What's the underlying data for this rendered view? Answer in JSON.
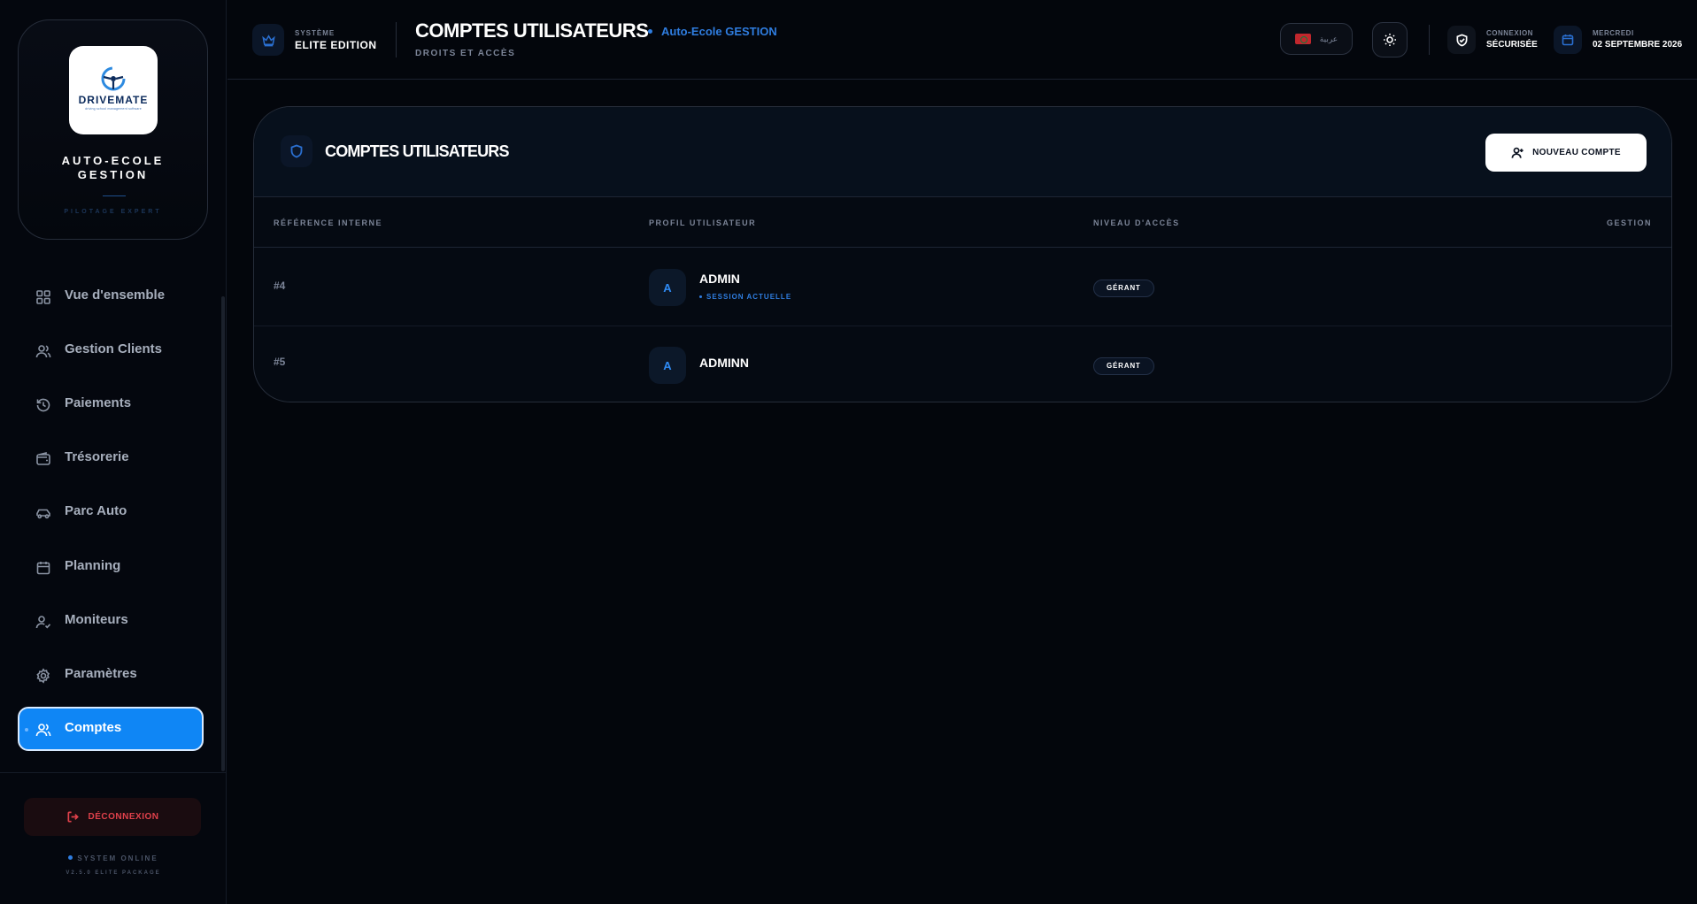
{
  "sidebar": {
    "logo": {
      "name": "DRIVEMATE",
      "tagline": "driving school management software"
    },
    "brand_title_line1": "AUTO-ECOLE",
    "brand_title_line2": "GESTION",
    "brand_subtitle": "PILOTAGE EXPERT",
    "items": [
      {
        "label": "Vue d'ensemble",
        "icon": "grid-icon"
      },
      {
        "label": "Gestion Clients",
        "icon": "users-icon"
      },
      {
        "label": "Paiements",
        "icon": "history-icon"
      },
      {
        "label": "Trésorerie",
        "icon": "wallet-icon"
      },
      {
        "label": "Parc Auto",
        "icon": "car-icon"
      },
      {
        "label": "Planning",
        "icon": "calendar-icon"
      },
      {
        "label": "Moniteurs",
        "icon": "user-check-icon"
      },
      {
        "label": "Paramètres",
        "icon": "gear-icon"
      },
      {
        "label": "Comptes",
        "icon": "users-icon",
        "active": true
      }
    ],
    "logout_label": "DÉCONNEXION",
    "status": "SYSTEM ONLINE",
    "version": "V2.5.0 ELITE PACKAGE"
  },
  "header": {
    "system_label": "SYSTÈME",
    "system_value": "ELITE EDITION",
    "title": "COMPTES UTILISATEURS",
    "school": "Auto-Ecole GESTION",
    "subtitle": "DROITS ET ACCÈS",
    "language": "عربية",
    "connection_label": "CONNEXION",
    "connection_value": "SÉCURISÉE",
    "day_label": "MERCREDI",
    "date_value": "02 SEPTEMBRE 2026"
  },
  "main": {
    "card_title": "COMPTES UTILISATEURS",
    "new_button": "NOUVEAU COMPTE",
    "columns": [
      "RÉFÉRENCE INTERNE",
      "PROFIL UTILISATEUR",
      "NIVEAU D'ACCÈS",
      "GESTION"
    ],
    "rows": [
      {
        "ref": "#4",
        "initial": "A",
        "name": "ADMIN",
        "session": "SESSION ACTUELLE",
        "role": "GÉRANT"
      },
      {
        "ref": "#5",
        "initial": "A",
        "name": "ADMINN",
        "role": "GÉRANT"
      }
    ]
  },
  "colors": {
    "accent": "#0f86f5",
    "danger": "#e0414b",
    "background": "#03060c"
  }
}
